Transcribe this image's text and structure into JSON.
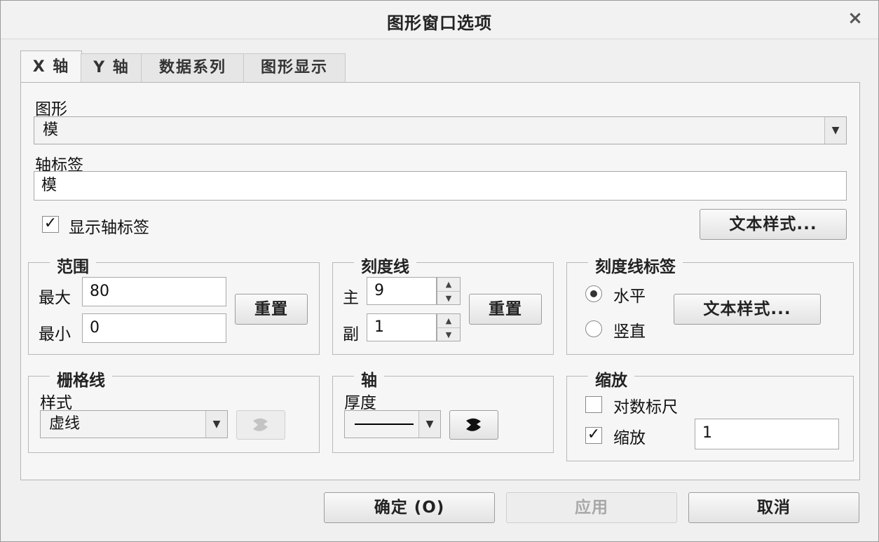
{
  "dialog": {
    "title": "图形窗口选项",
    "close": "×"
  },
  "tabs": [
    "X 轴",
    "Y 轴",
    "数据系列",
    "图形显示"
  ],
  "graph": {
    "label": "图形",
    "value": "模"
  },
  "axis_label": {
    "label": "轴标签",
    "value": "模"
  },
  "show_axis_label": {
    "label": "显示轴标签",
    "checked": true
  },
  "text_style_button": "文本样式...",
  "range": {
    "title": "范围",
    "max_label": "最大",
    "max_value": "80",
    "min_label": "最小",
    "min_value": "0",
    "reset": "重置"
  },
  "ticks": {
    "title": "刻度线",
    "major_label": "主",
    "major_value": "9",
    "minor_label": "副",
    "minor_value": "1",
    "reset": "重置"
  },
  "tick_labels": {
    "title": "刻度线标签",
    "horizontal": "水平",
    "vertical": "竖直",
    "selected": "horizontal",
    "text_style": "文本样式..."
  },
  "grid": {
    "title": "栅格线",
    "style_label": "样式",
    "style_value": "虚线",
    "color_button_enabled": false
  },
  "axis": {
    "title": "轴",
    "thickness_label": "厚度",
    "color_button_enabled": true
  },
  "scale": {
    "title": "缩放",
    "log_label": "对数标尺",
    "log_checked": false,
    "scale_label": "缩放",
    "scale_checked": true,
    "scale_value": "1"
  },
  "footer": {
    "ok": "确定 (O)",
    "apply": "应用",
    "cancel": "取消"
  }
}
